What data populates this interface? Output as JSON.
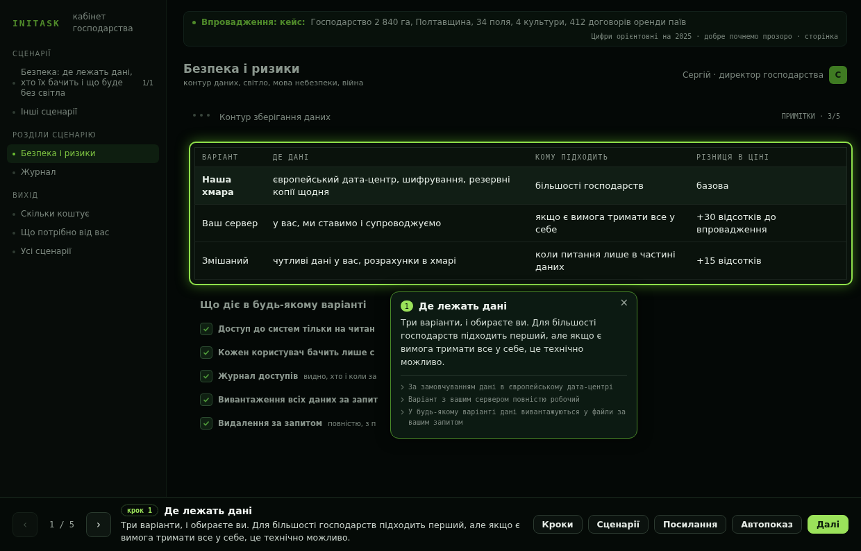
{
  "sidebar": {
    "logo": "INITASK",
    "subtitle": "кабінет господарства",
    "sections": [
      {
        "heading": "СЦЕНАРІЇ",
        "items": [
          {
            "label": "Безпека: де лежать дані, хто їх бачить і що буде без світла",
            "badge": "1/1",
            "selected": false
          },
          {
            "label": "Інші сценарії",
            "selected": false
          }
        ]
      },
      {
        "heading": "РОЗДІЛИ СЦЕНАРІЮ",
        "items": [
          {
            "label": "Безпека і ризики",
            "selected": true
          },
          {
            "label": "Журнал",
            "selected": false
          }
        ]
      },
      {
        "heading": "ВИХІД",
        "items": [
          {
            "label": "Скільки коштує",
            "selected": false
          },
          {
            "label": "Що потрібно від вас",
            "selected": false
          },
          {
            "label": "Усі сценарії",
            "selected": false
          }
        ]
      }
    ]
  },
  "case_banner": {
    "label": "Впровадження: кейс:",
    "text": "Господарство 2 840 га, Полтавщина, 34 поля, 4 культури, 412 договорів оренди паїв",
    "note": "Цифри орієнтовні на 2025 · добре почнемо прозоро · сторінка"
  },
  "header": {
    "title": "Безпека і ризики",
    "subtitle": "контур даних, світло, мова небезпеки, війна",
    "user": "Сергій · директор господарства",
    "avatar": "С"
  },
  "panel": {
    "title": "Контур зберігання даних",
    "meta": "ПРИМІТКИ · 3/5",
    "table": {
      "columns": [
        "ВАРІАНТ",
        "ДЕ ДАНІ",
        "КОМУ ПІДХОДИТЬ",
        "РІЗНИЦЯ В ЦІНІ"
      ],
      "rows": [
        {
          "cells": [
            "Наша хмара",
            "європейський дата-центр, шифрування, резервні копії щодня",
            "більшості господарств",
            "базова"
          ],
          "selected": true
        },
        {
          "cells": [
            "Ваш сервер",
            "у вас, ми ставимо і супроводжуємо",
            "якщо є вимога тримати все у себе",
            "+30 відсотків до впровадження"
          ],
          "selected": false
        },
        {
          "cells": [
            "Змішаний",
            "чутливі дані у вас, розрахунки в хмарі",
            "коли питання лише в частині даних",
            "+15 відсотків"
          ],
          "selected": false
        }
      ]
    }
  },
  "guarantees": {
    "title": "Що діє в будь-якому варіанті",
    "items": [
      {
        "label": "Доступ до систем тільки на читан",
        "checked": true
      },
      {
        "label": "Кожен користувач бачить лише с",
        "checked": true
      },
      {
        "label": "Журнал доступів",
        "note": "видно, хто і коли за",
        "checked": true
      },
      {
        "label": "Вивантаження всіх даних за запит",
        "checked": true
      },
      {
        "label": "Видалення за запитом",
        "note": "повністю, з п",
        "checked": true
      }
    ]
  },
  "popover": {
    "step": "1",
    "title": "Де лежать дані",
    "body": "Три варіанти, і обираєте ви. Для більшості господарств підходить перший, але якщо є вимога тримати все у себе, це технічно можливо.",
    "close": "×",
    "points": [
      "За замовчуванням дані в європейському дата-центрі",
      "Варіант з вашим сервером повністю робочий",
      "У будь-якому варіанті дані вивантажуються у файли за вашим запитом"
    ]
  },
  "tour_bar": {
    "prev": "‹",
    "prev_disabled": true,
    "counter": "1 / 5",
    "next": "›",
    "step_label": "крок 1",
    "title": "Де лежать дані",
    "body": "Три варіанти, і обираєте ви. Для більшості господарств підходить перший, але якщо є вимога тримати все у себе, це технічно можливо.",
    "buttons": [
      {
        "label": "Кроки",
        "primary": false
      },
      {
        "label": "Сценарії",
        "primary": false
      },
      {
        "label": "Посилання",
        "primary": false
      },
      {
        "label": "Автопоказ",
        "primary": false
      },
      {
        "label": "Далі",
        "primary": true
      }
    ]
  }
}
